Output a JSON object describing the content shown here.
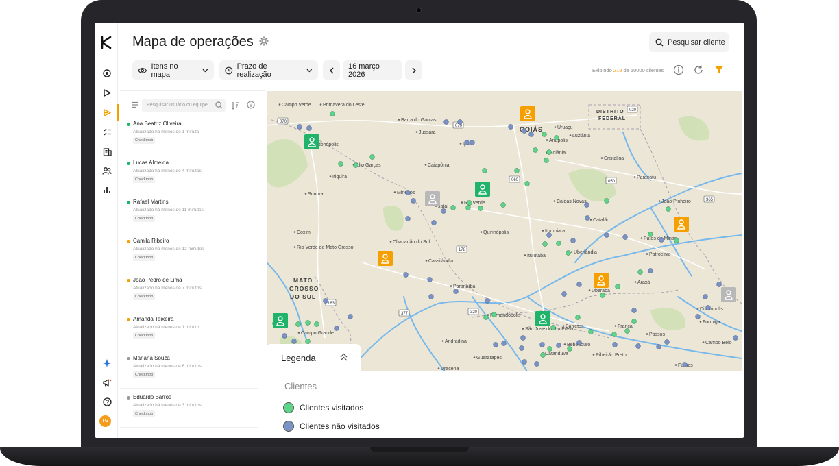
{
  "app": {
    "title": "Mapa de operações",
    "search_client_label": "Pesquisar cliente"
  },
  "toolbar": {
    "items_on_map_label": "Itens no mapa",
    "deadline_label": "Prazo de realização",
    "date_label": "16 março 2026",
    "status_prefix": "Exibindo",
    "status_count": "218",
    "status_suffix": "de 10000 clientes"
  },
  "sidebar": {
    "search_placeholder": "Pesquisar usuário ou equipe",
    "avatar_initials": "TG",
    "users": [
      {
        "name": "Ana Beatriz Oliveira",
        "updated": "Atualizado há menos de 1 minuto",
        "tag": "Checkmob",
        "status_color": "#1fb46a"
      },
      {
        "name": "Lucas Almeida",
        "updated": "Atualizado há menos de 4 minutos",
        "tag": "Checkmob",
        "status_color": "#1fb46a"
      },
      {
        "name": "Rafael Martins",
        "updated": "Atualizado há menos de 11 minutos",
        "tag": "Checkmob",
        "status_color": "#1fb46a"
      },
      {
        "name": "Camila Ribeiro",
        "updated": "Atualizado há menos de 12 minutos",
        "tag": "Checkmob",
        "status_color": "#f5a000"
      },
      {
        "name": "João Pedro de Lima",
        "updated": "Atualizado há menos de 7 minutos",
        "tag": "Checkmob",
        "status_color": "#f5a000"
      },
      {
        "name": "Amanda Teixeira",
        "updated": "Atualizado há menos de 1 minuto",
        "tag": "Checkmob",
        "status_color": "#f5a000"
      },
      {
        "name": "Mariana Souza",
        "updated": "Atualizado há menos de 6 minutos",
        "tag": "Checkmob",
        "status_color": "#9a9a9a"
      },
      {
        "name": "Eduardo Barros",
        "updated": "Atualizado há menos de 3 minutos",
        "tag": "Checkmob",
        "status_color": "#9a9a9a"
      }
    ]
  },
  "legend": {
    "title": "Legenda",
    "subtitle": "Clientes",
    "visited_label": "Clientes visitados",
    "not_visited_label": "Clientes não visitados",
    "visited_color": "#5fd38a",
    "not_visited_color": "#7b93c4"
  },
  "map": {
    "region_labels": {
      "goias": "GOIÁS",
      "df_line1": "DISTRITO",
      "df_line2": "FEDERAL",
      "ms_line1": "MATO",
      "ms_line2": "GROSSO",
      "ms_line3": "DO SUL"
    },
    "cities": [
      "Campo Verde",
      "Primavera do Leste",
      "Barra do Garças",
      "Goiânia",
      "Anápolis",
      "Luziânia",
      "Rondonópolis",
      "Alto Garças",
      "Caiapônia",
      "Itiquira",
      "Mineiros",
      "Jataí",
      "Rio Verde",
      "Sonora",
      "Cristalina",
      "Paracatu",
      "Caldas Novas",
      "João Pinheiro",
      "Catalão",
      "Itumbiara",
      "Quirinópolis",
      "Coxim",
      "Rio Verde de Mato Grosso",
      "Chapadão do Sul",
      "Cassilândia",
      "Ituiutaba",
      "Uberlândia",
      "Patos de Minas",
      "Patrocínio",
      "Uberaba",
      "Araxá",
      "Paranaíba",
      "Divinópolis",
      "Fernandópolis",
      "São José do Rio Preto",
      "Barretos",
      "Franca",
      "Formiga",
      "Campo Grande",
      "Passos",
      "Campo Belo",
      "Andradina",
      "Catanduva",
      "Bebedouro",
      "Ribeirão Preto",
      "Guararapes",
      "Dracena",
      "Furnas",
      "Ipora",
      "Jussara",
      "Uruaçu"
    ],
    "roads": [
      "070",
      "070",
      "020",
      "060",
      "050",
      "365",
      "178",
      "163",
      "377",
      "320"
    ]
  }
}
